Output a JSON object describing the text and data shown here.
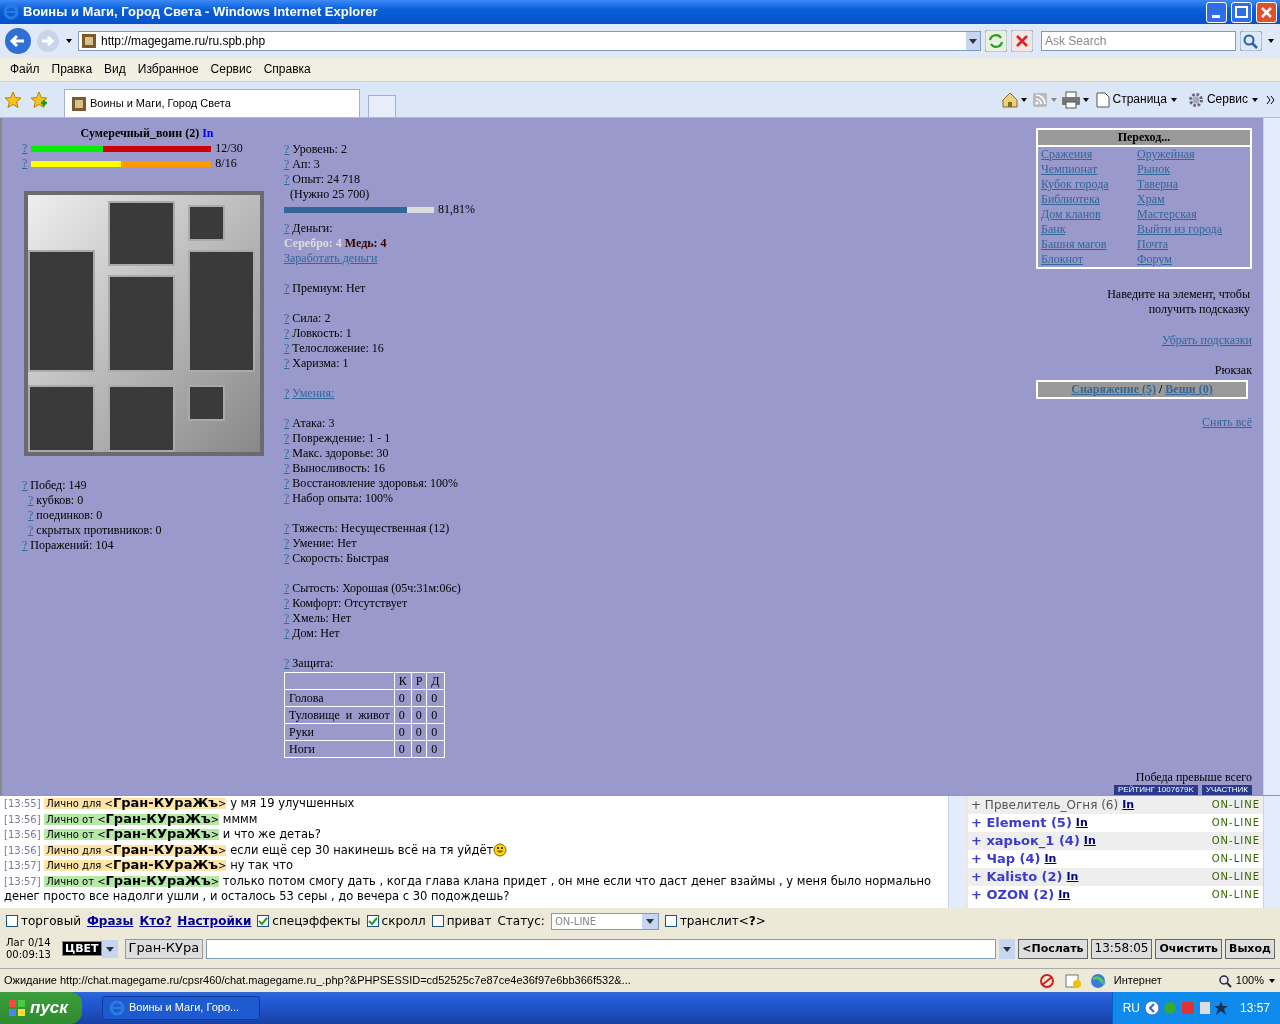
{
  "browser": {
    "title": "Воины и Маги, Город Света - Windows Internet Explorer",
    "address": "http://magegame.ru/ru.spb.php",
    "search_placeholder": "Ask Search",
    "menu": [
      "Файл",
      "Правка",
      "Вид",
      "Избранное",
      "Сервис",
      "Справка"
    ],
    "tab": "Воины и Маги, Город Света",
    "commands": [
      "Страница",
      "Сервис"
    ]
  },
  "character": {
    "name": "Сумеречный_воин (2)",
    "link": "In",
    "bars": [
      {
        "help": "?",
        "kind": "health",
        "level": 0.4,
        "reading": "12/30"
      },
      {
        "help": "?",
        "kind": "mana",
        "level": 0.5,
        "reading": "8/16"
      }
    ],
    "record": [
      {
        "help": "?",
        "text": "Побед: 149",
        "children": [
          {
            "help": "?",
            "text": "кубков: 0"
          },
          {
            "help": "?",
            "text": "поединков: 0"
          },
          {
            "help": "?",
            "text": "скрытых противников: 0"
          }
        ]
      },
      {
        "help": "?",
        "text": "Поражений: 104"
      }
    ]
  },
  "stats": {
    "top": [
      {
        "help": "?",
        "text": "Уровень: 2"
      },
      {
        "help": "?",
        "text": "Ап: 3"
      },
      {
        "help": "?",
        "text": "Опыт: 24 718"
      }
    ],
    "needed": "(Нужно 25 700)",
    "experience": {
      "level": 0.8181,
      "reading": "81,81%"
    },
    "money": {
      "help": "?",
      "label": "Деньги:",
      "silver": "Серебро: 4",
      "copper": "Медь: 4",
      "earn": "Заработать деньги"
    },
    "groups": [
      [
        {
          "help": "?",
          "text": "Премиум: Нет"
        }
      ],
      [
        {
          "help": "?",
          "text": "Сила: 2"
        },
        {
          "help": "?",
          "text": "Ловкость: 1"
        },
        {
          "help": "?",
          "text": "Телосложение: 16"
        },
        {
          "help": "?",
          "text": "Харизма: 1"
        }
      ],
      [
        {
          "help": "?",
          "text": "Умения:",
          "kind": "link"
        }
      ],
      [
        {
          "help": "?",
          "text": "Атака: 3"
        },
        {
          "help": "?",
          "text": "Повреждение: 1 - 1"
        },
        {
          "help": "?",
          "text": "Макс. здоровье: 30"
        },
        {
          "help": "?",
          "text": "Выносливость: 16"
        },
        {
          "help": "?",
          "text": "Восстановление здоровья: 100%"
        },
        {
          "help": "?",
          "text": "Набор опыта: 100%"
        }
      ],
      [
        {
          "help": "?",
          "text": "Тяжесть: Несущественная (12)"
        },
        {
          "help": "?",
          "text": "Умение: Нет"
        },
        {
          "help": "?",
          "text": "Скорость: Быстрая"
        }
      ],
      [
        {
          "help": "?",
          "text": "Сытость: Хорошая (05ч:31м:06с)"
        },
        {
          "help": "?",
          "text": "Комфорт: Отсутствует"
        },
        {
          "help": "?",
          "text": "Хмель: Нет"
        },
        {
          "help": "?",
          "text": "Дом: Нет"
        }
      ],
      [
        {
          "help": "?",
          "text": "Защита:"
        }
      ]
    ],
    "protection": {
      "columns": [
        "К",
        "Р",
        "Д"
      ],
      "rows": [
        {
          "part": "Голова",
          "values": [
            "0",
            "0",
            "0"
          ]
        },
        {
          "part": "Туловище и живот",
          "values": [
            "0",
            "0",
            "0"
          ]
        },
        {
          "part": "Руки",
          "values": [
            "0",
            "0",
            "0"
          ]
        },
        {
          "part": "Ноги",
          "values": [
            "0",
            "0",
            "0"
          ]
        }
      ]
    }
  },
  "navigation": {
    "title": "Переход...",
    "links": [
      "Сражения",
      "Оружейная",
      "Чемпионат",
      "Рынок",
      "Кубок города",
      "Таверна",
      "Библиотека",
      "Храм",
      "Дом кланов",
      "Мастерская",
      "Банк",
      "Выйти из города",
      "Башня магов",
      "Почта",
      "Блокнот",
      "Форум"
    ]
  },
  "hint": "Наведите на элемент, чтобы получить подсказку",
  "hide_hints": "Убрать подсказки",
  "backpack": {
    "title": "Рюкзак",
    "tabs": [
      "Снаряжение (5)",
      "Вещи (0)"
    ],
    "separator": "/"
  },
  "unequip": "Снять всё",
  "motto": "Победа превыше всего",
  "banners": [
    {
      "label": "РЕЙТИНГ",
      "value": "1007679K"
    },
    {
      "label": "УЧАСТНИК"
    }
  ],
  "chat": [
    {
      "time": "[13:55]",
      "kind": "to",
      "direction": "Лично для",
      "nick": "<**Гран-КУраЖъ**>",
      "text": "у мя 19 улучшенных"
    },
    {
      "time": "[13:56]",
      "kind": "from",
      "direction": "Лично от",
      "nick": "<**Гран-КУраЖъ**>",
      "text": "мммм"
    },
    {
      "time": "[13:56]",
      "kind": "from",
      "direction": "Лично от",
      "nick": "<**Гран-КУраЖъ**>",
      "text": "и что же детаь?"
    },
    {
      "time": "[13:56]",
      "kind": "to",
      "direction": "Лично для",
      "nick": "<**Гран-КУраЖъ**>",
      "text": "если ещё сер 30 накинешь всё на тя уйдёт",
      "smiley": true
    },
    {
      "time": "[13:57]",
      "kind": "to",
      "direction": "Лично для",
      "nick": "<**Гран-КУраЖъ**>",
      "text": "ну так что"
    },
    {
      "time": "[13:57]",
      "kind": "from",
      "direction": "Лично от",
      "nick": "<**Гран-КУраЖъ**>",
      "text": "только потом смогу дать , когда глава клана придет , он мне если что даст денег взаймы , у меня было нормально денег просто все надолги ушли , и осталось 53 серы , до вечера с 30 подождешь?"
    }
  ],
  "online": [
    {
      "prefix": "+",
      "name": "Првелитель_Огня (6)",
      "link": "In",
      "status": "ON-LINE",
      "bold": false
    },
    {
      "prefix": "+",
      "name": "Element (5)",
      "link": "In",
      "status": "ON-LINE",
      "bold": true
    },
    {
      "prefix": "+",
      "name": "харьок_1 (4)",
      "link": "In",
      "status": "ON-LINE",
      "bold": true
    },
    {
      "prefix": "+",
      "name": "Чар (4)",
      "link": "In",
      "status": "ON-LINE",
      "bold": true
    },
    {
      "prefix": "+",
      "name": "Kalisto (2)",
      "link": "In",
      "status": "ON-LINE",
      "bold": true
    },
    {
      "prefix": "+",
      "name": "OZON (2)",
      "link": "In",
      "status": "ON-LINE",
      "bold": true
    }
  ],
  "controls": [
    {
      "kind": "checkbox",
      "label": "торговый",
      "checked": false
    },
    {
      "kind": "link",
      "label": "Фразы"
    },
    {
      "kind": "link",
      "label": "Кто?"
    },
    {
      "kind": "link",
      "label": "Настройки"
    },
    {
      "kind": "checkbox",
      "label": "спецэффекты",
      "checked": true
    },
    {
      "kind": "checkbox",
      "label": "скролл",
      "checked": true
    },
    {
      "kind": "checkbox",
      "label": "приват",
      "checked": false
    },
    {
      "kind": "select",
      "label": "Статус:",
      "value": "ON-LINE"
    },
    {
      "kind": "checkbox",
      "label": "транслит",
      "checked": false
    },
    {
      "kind": "help",
      "before": "<",
      "link": "?",
      "after": ">"
    }
  ],
  "input_row": {
    "lag": "Лаг 0/14",
    "timer": "00:09:13",
    "color_label": "ЦВЕТ",
    "recipient": "Гран-КУра",
    "buttons": [
      "<Послать",
      "13:58:05",
      "Очистить",
      "Выход"
    ]
  },
  "status_bar": {
    "text": "Ожидание http://chat.magegame.ru/cpsr460/chat.magegame.ru_.php?&PHPSESSID=cd52525c7e87ce4e36f97e6bb366f532&...",
    "zone": "Интернет",
    "zoom": "100%"
  },
  "taskbar": {
    "start": "пуск",
    "window": "Воины и Маги, Горо...",
    "language": "RU",
    "clock": "13:57"
  }
}
